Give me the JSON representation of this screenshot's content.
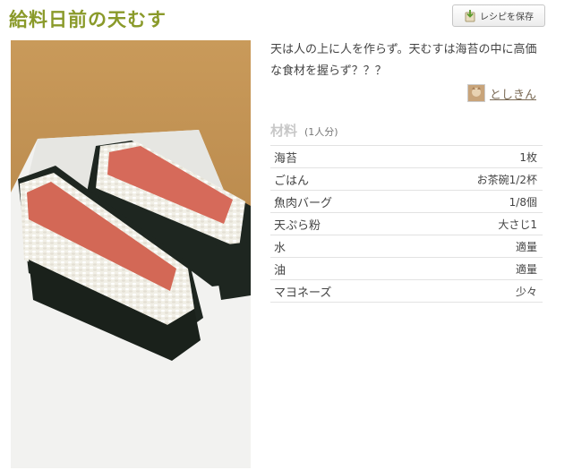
{
  "recipe": {
    "title": "給料日前の天むす",
    "save_button_label": "レシピを保存",
    "description": "天は人の上に人を作らず。天むすは海苔の中に高価な食材を握らず？？？",
    "author": "としきん"
  },
  "ingredients": {
    "heading": "材料",
    "servings": "(1人分)",
    "items": [
      {
        "name": "海苔",
        "qty": "1枚"
      },
      {
        "name": "ごはん",
        "qty": "お茶碗1/2杯"
      },
      {
        "name": "魚肉バーグ",
        "qty": "1/8個"
      },
      {
        "name": "天ぷら粉",
        "qty": "大さじ1"
      },
      {
        "name": "水",
        "qty": "適量"
      },
      {
        "name": "油",
        "qty": "適量"
      },
      {
        "name": "マヨネーズ",
        "qty": "少々"
      }
    ]
  },
  "colors": {
    "title": "#8a9a2a",
    "table_border": "#e2e2e2"
  },
  "icons": {
    "save": "recipe-save-icon",
    "avatar": "user-avatar"
  }
}
